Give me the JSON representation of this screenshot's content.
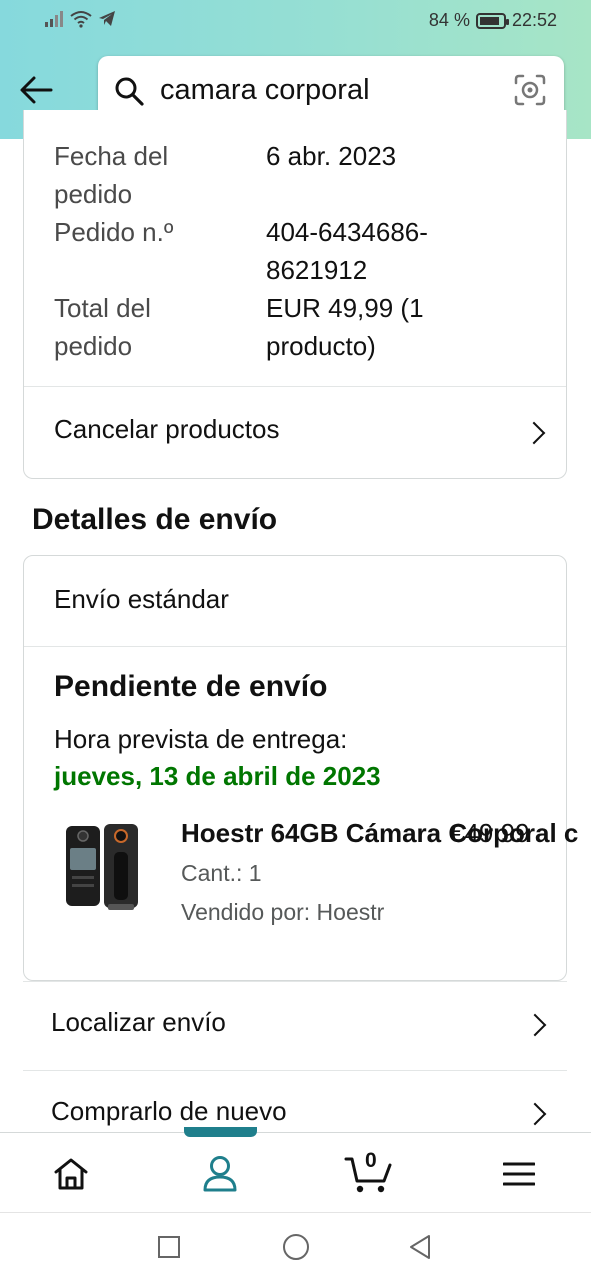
{
  "status_bar": {
    "battery_percent": "84 %",
    "time": "22:52"
  },
  "search": {
    "query": "camara corporal"
  },
  "order_summary": {
    "rows": [
      {
        "label": "Fecha del pedido",
        "value": "6 abr. 2023"
      },
      {
        "label": "Pedido n.º",
        "value": "404-6434686-8621912"
      },
      {
        "label": "Total del pedido",
        "value": "EUR 49,99 (1 producto)"
      }
    ],
    "cancel_label": "Cancelar productos"
  },
  "shipping": {
    "section_title": "Detalles de envío",
    "method": "Envío estándar",
    "status_title": "Pendiente de envío",
    "eta_label": "Hora prevista de entrega:",
    "eta_date": "jueves, 13 de abril de 2023",
    "eta_color": "#007600",
    "product": {
      "title": "Hoestr 64GB Cámara Corporal c",
      "price": "€49,99",
      "qty": "Cant.: 1",
      "seller": "Vendido por: Hoestr"
    }
  },
  "actions": {
    "track": "Localizar envío",
    "buy_again": "Comprarlo de nuevo"
  },
  "bottom_nav": {
    "cart_count": "0",
    "accent": "#1f7f8c"
  }
}
